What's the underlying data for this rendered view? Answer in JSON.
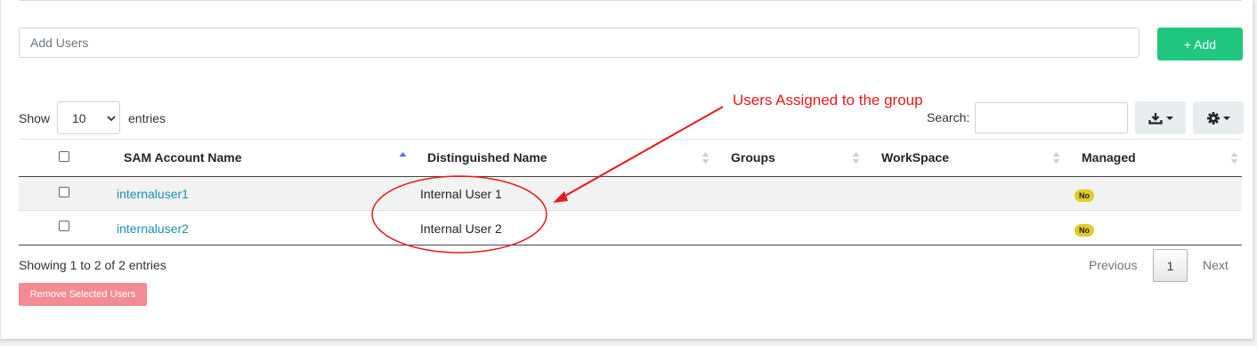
{
  "add_users": {
    "placeholder": "Add Users",
    "button_label": "+ Add"
  },
  "length_control": {
    "show_label": "Show",
    "selected": "10",
    "entries_label": "entries"
  },
  "search": {
    "label": "Search:",
    "value": ""
  },
  "annotation": {
    "text": "Users Assigned to the group",
    "color": "#e8191b"
  },
  "table": {
    "columns": [
      "SAM Account Name",
      "Distinguished Name",
      "Groups",
      "WorkSpace",
      "Managed"
    ],
    "sorted_column": "SAM Account Name",
    "rows": [
      {
        "sam": "internaluser1",
        "dn": "Internal User 1",
        "groups": "",
        "workspace": "",
        "managed": "No"
      },
      {
        "sam": "internaluser2",
        "dn": "Internal User 2",
        "groups": "",
        "workspace": "",
        "managed": "No"
      }
    ]
  },
  "footer": {
    "info": "Showing 1 to 2 of 2 entries",
    "remove_button": "Remove Selected Users",
    "previous": "Previous",
    "current_page": "1",
    "next": "Next"
  },
  "colors": {
    "accent_green": "#20c77e",
    "link_blue": "#1a8fb4",
    "badge_yellow": "#e2cc26",
    "danger_pink": "#f28b92"
  }
}
